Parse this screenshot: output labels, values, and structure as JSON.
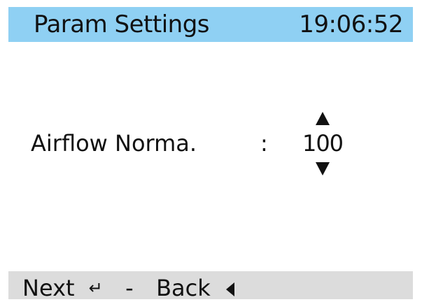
{
  "header": {
    "title": "Param Settings",
    "time": "19:06:52",
    "background": "#8fd0f3"
  },
  "parameter": {
    "label": "Airflow  Norma.",
    "separator": ":",
    "value": "100",
    "increase_icon": "triangle-up-icon",
    "decrease_icon": "triangle-down-icon"
  },
  "footer": {
    "next_label": "Next",
    "enter_glyph": "↵",
    "dash": "-",
    "back_label": "Back",
    "enter_icon": "enter-icon",
    "back_icon": "triangle-left-icon",
    "background": "#dcdcdc"
  }
}
